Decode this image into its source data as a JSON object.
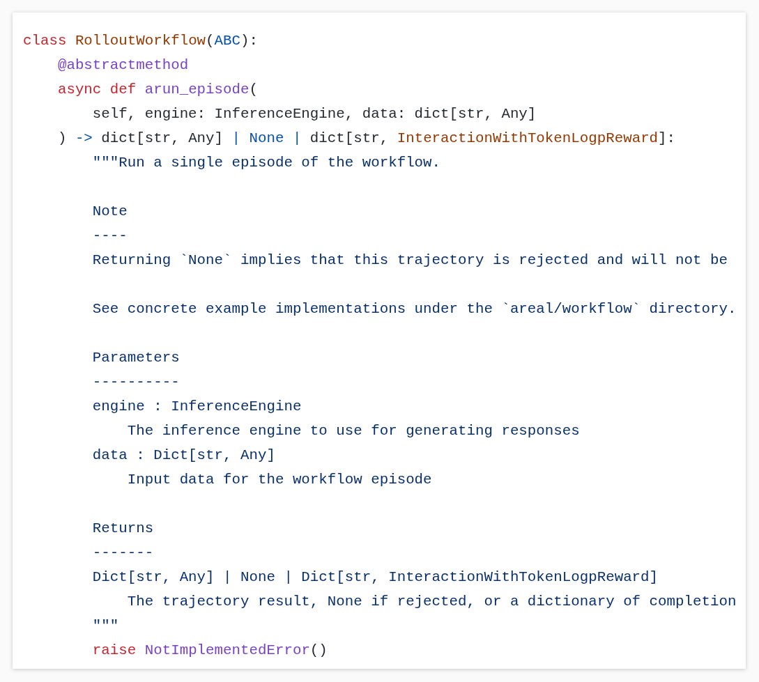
{
  "code_lines": [
    {
      "kind": "code",
      "tokens": [
        {
          "text": "class ",
          "kind": "keyword"
        },
        {
          "text": "RolloutWorkflow",
          "kind": "class"
        },
        {
          "text": "(",
          "kind": "plain"
        },
        {
          "text": "ABC",
          "kind": "builtin"
        },
        {
          "text": "):",
          "kind": "plain"
        }
      ]
    },
    {
      "kind": "code",
      "tokens": [
        {
          "text": "    @abstractmethod",
          "kind": "func"
        }
      ]
    },
    {
      "kind": "code",
      "tokens": [
        {
          "text": "    async def ",
          "kind": "keyword"
        },
        {
          "text": "arun_episode",
          "kind": "func"
        },
        {
          "text": "(",
          "kind": "plain"
        }
      ]
    },
    {
      "kind": "code",
      "tokens": [
        {
          "text": "        self, engine: InferenceEngine, data: dict[str, Any]",
          "kind": "plain"
        }
      ]
    },
    {
      "kind": "code",
      "tokens": [
        {
          "text": "    ) ",
          "kind": "plain"
        },
        {
          "text": "->",
          "kind": "builtin"
        },
        {
          "text": " dict[str, Any] ",
          "kind": "plain"
        },
        {
          "text": "| None |",
          "kind": "builtin"
        },
        {
          "text": " dict[str, ",
          "kind": "plain"
        },
        {
          "text": "InteractionWithTokenLogpReward",
          "kind": "class"
        },
        {
          "text": "]:",
          "kind": "plain"
        }
      ]
    },
    {
      "kind": "code",
      "tokens": [
        {
          "text": "        \"\"\"Run a single episode of the workflow.",
          "kind": "string"
        }
      ]
    },
    {
      "kind": "blank"
    },
    {
      "kind": "code",
      "tokens": [
        {
          "text": "        Note",
          "kind": "string"
        }
      ]
    },
    {
      "kind": "code",
      "tokens": [
        {
          "text": "        ----",
          "kind": "string"
        }
      ]
    },
    {
      "kind": "code",
      "tokens": [
        {
          "text": "        Returning `None` implies that this trajectory is rejected and will not be",
          "kind": "string"
        }
      ]
    },
    {
      "kind": "blank"
    },
    {
      "kind": "code",
      "tokens": [
        {
          "text": "        See concrete example implementations under the `areal/workflow` directory.",
          "kind": "string"
        }
      ]
    },
    {
      "kind": "blank"
    },
    {
      "kind": "code",
      "tokens": [
        {
          "text": "        Parameters",
          "kind": "string"
        }
      ]
    },
    {
      "kind": "code",
      "tokens": [
        {
          "text": "        ----------",
          "kind": "string"
        }
      ]
    },
    {
      "kind": "code",
      "tokens": [
        {
          "text": "        engine : InferenceEngine",
          "kind": "string"
        }
      ]
    },
    {
      "kind": "code",
      "tokens": [
        {
          "text": "            The inference engine to use for generating responses",
          "kind": "string"
        }
      ]
    },
    {
      "kind": "code",
      "tokens": [
        {
          "text": "        data : Dict[str, Any]",
          "kind": "string"
        }
      ]
    },
    {
      "kind": "code",
      "tokens": [
        {
          "text": "            Input data for the workflow episode",
          "kind": "string"
        }
      ]
    },
    {
      "kind": "blank"
    },
    {
      "kind": "code",
      "tokens": [
        {
          "text": "        Returns",
          "kind": "string"
        }
      ]
    },
    {
      "kind": "code",
      "tokens": [
        {
          "text": "        -------",
          "kind": "string"
        }
      ]
    },
    {
      "kind": "code",
      "tokens": [
        {
          "text": "        Dict[str, Any] | None | Dict[str, InteractionWithTokenLogpReward]",
          "kind": "string"
        }
      ]
    },
    {
      "kind": "code",
      "tokens": [
        {
          "text": "            The trajectory result, None if rejected, or a dictionary of completion",
          "kind": "string"
        }
      ]
    },
    {
      "kind": "code",
      "tokens": [
        {
          "text": "        \"\"\"",
          "kind": "string"
        }
      ]
    },
    {
      "kind": "code",
      "tokens": [
        {
          "text": "        raise ",
          "kind": "keyword"
        },
        {
          "text": "NotImplementedError",
          "kind": "func"
        },
        {
          "text": "()",
          "kind": "plain"
        }
      ]
    }
  ]
}
